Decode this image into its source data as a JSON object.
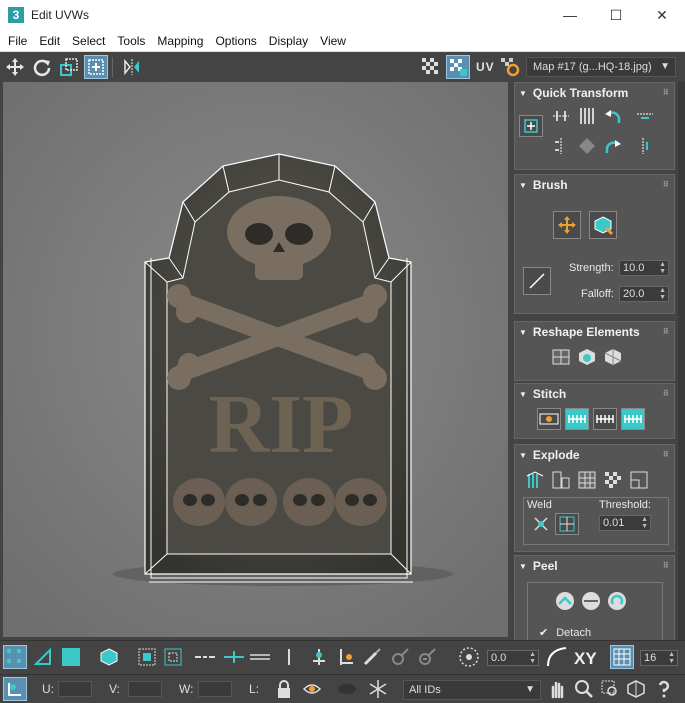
{
  "window": {
    "app_icon": "3",
    "title": "Edit UVWs",
    "minimize": "—",
    "maximize": "☐",
    "close": "✕"
  },
  "menu": [
    "File",
    "Edit",
    "Select",
    "Tools",
    "Mapping",
    "Options",
    "Display",
    "View"
  ],
  "toolbar": {
    "uv_label": "UV",
    "map_select": "Map #17 (g...HQ-18.jpg)"
  },
  "viewport": {
    "engraving": "RIP"
  },
  "panels": {
    "quick_transform": "Quick Transform",
    "brush": "Brush",
    "strength_label": "Strength:",
    "strength_value": "10.0",
    "falloff_label": "Falloff:",
    "falloff_value": "20.0",
    "reshape": "Reshape Elements",
    "stitch": "Stitch",
    "explode": "Explode",
    "weld_label": "Weld",
    "threshold_label": "Threshold:",
    "threshold_value": "0.01",
    "peel": "Peel",
    "detach_label": "Detach"
  },
  "bottom": {
    "spinner_value": "0.0",
    "xy_label": "XY",
    "grid_value": "16",
    "u_label": "U:",
    "v_label": "V:",
    "w_label": "W:",
    "l_label": "L:",
    "ids_dropdown": "All IDs"
  },
  "colors": {
    "accent_teal": "#3cc8c8",
    "active_blue": "#5a8fb0",
    "panel_bg": "#444444",
    "viewport_bg": "#7b7b7b"
  }
}
